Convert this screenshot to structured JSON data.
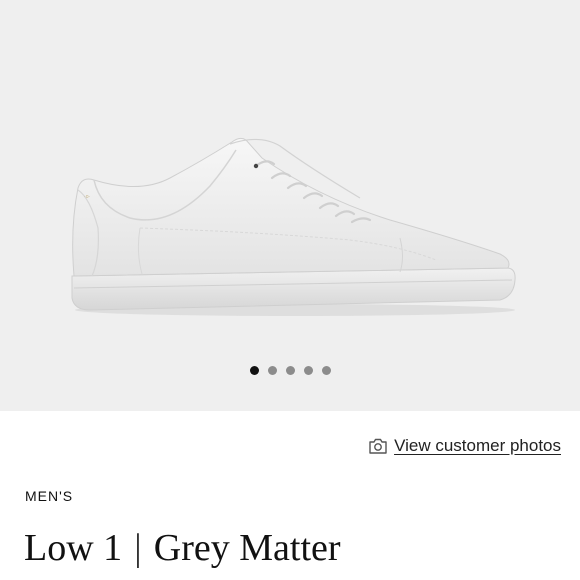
{
  "gallery": {
    "image_alt": "White low-top leather sneaker",
    "dots_total": 5,
    "active_index": 0
  },
  "photos_link": {
    "icon": "camera-icon",
    "label": "View customer photos"
  },
  "product": {
    "category": "MEN'S",
    "name": "Low 1",
    "separator": "|",
    "color": "Grey Matter"
  }
}
